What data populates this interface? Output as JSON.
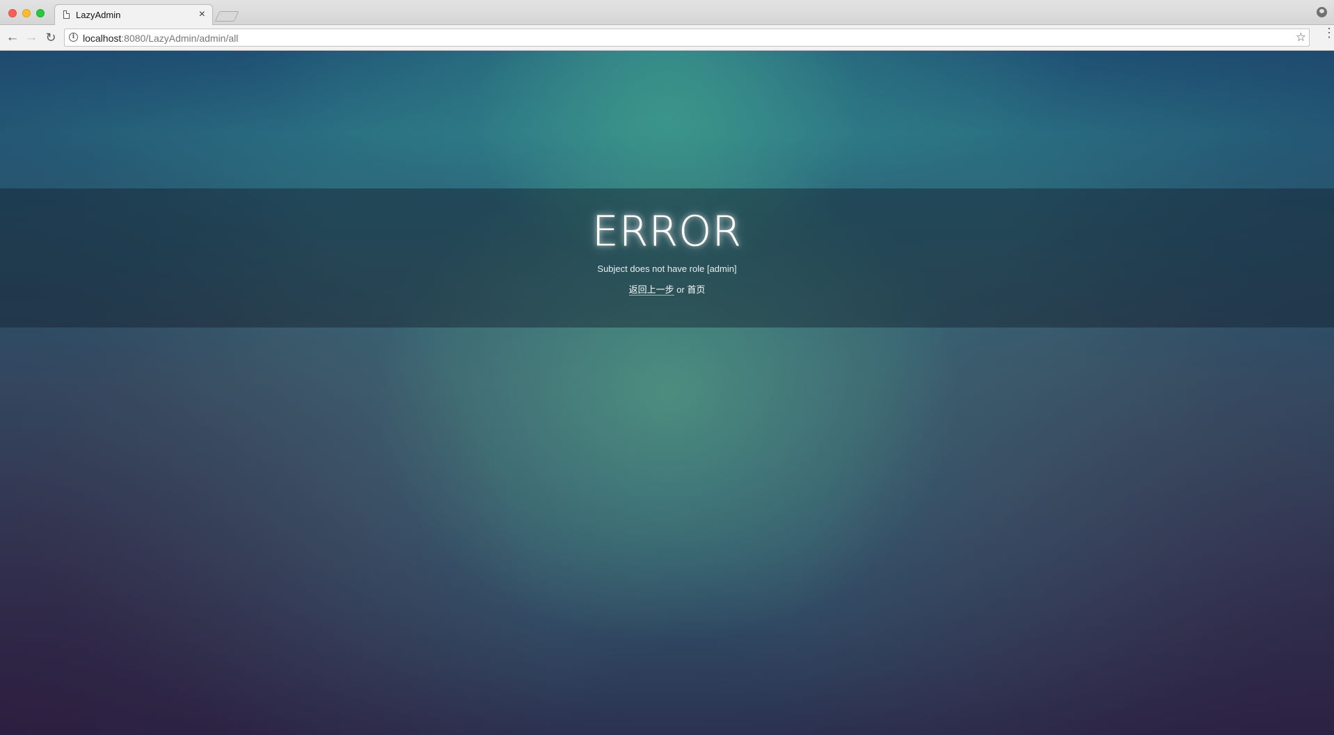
{
  "browser": {
    "tab_title": "LazyAdmin",
    "tab_close": "×",
    "url_host": "localhost",
    "url_path": ":8080/LazyAdmin/admin/all",
    "info_glyph": "i",
    "back_glyph": "←",
    "forward_glyph": "→",
    "reload_glyph": "↻",
    "star_glyph": "☆",
    "menu_glyph": "⋮"
  },
  "error": {
    "title": "ERROR",
    "message": "Subject does not have role [admin]",
    "back_link": "返回上一步",
    "separator": " or ",
    "home_link": "首页"
  }
}
